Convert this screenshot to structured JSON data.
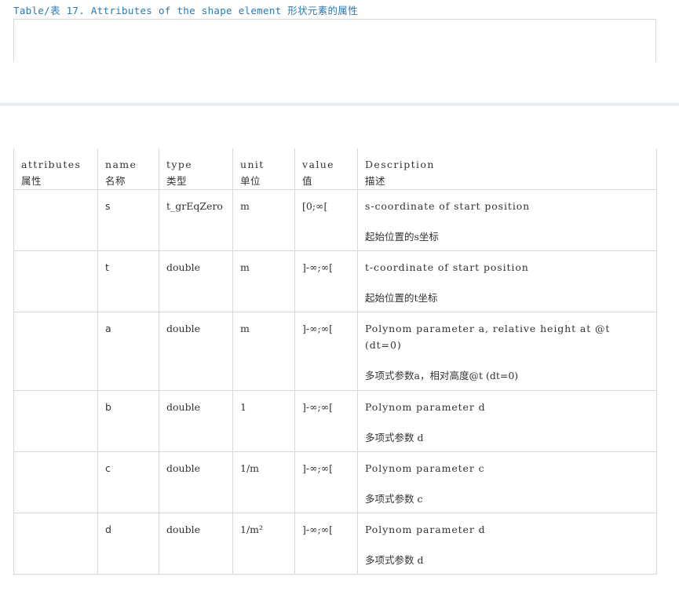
{
  "caption": "Table/表 17. Attributes of the shape element 形状元素的属性",
  "table": {
    "headers": {
      "attributes_en": "attributes",
      "attributes_cn": "属性",
      "name_en": "name",
      "name_cn": "名称",
      "type_en": "type",
      "type_cn": "类型",
      "unit_en": "unit",
      "unit_cn": "单位",
      "value_en": "value",
      "value_cn": "值",
      "desc_en": "Description",
      "desc_cn": "描述"
    },
    "rows": [
      {
        "attr": "",
        "name": "s",
        "type": "t_grEqZero",
        "unit": "m",
        "value": "[0;∞[",
        "desc_en": "s-coordinate of start position",
        "desc_cn": "起始位置的s坐标"
      },
      {
        "attr": "",
        "name": "t",
        "type": "double",
        "unit": "m",
        "value": "]-∞;∞[",
        "desc_en": "t-coordinate of start position",
        "desc_cn": "起始位置的t坐标"
      },
      {
        "attr": "",
        "name": "a",
        "type": "double",
        "unit": "m",
        "value": "]-∞;∞[",
        "desc_en": "Polynom parameter a, relative height at @t (dt=0)",
        "desc_cn": "多项式参数a，相对高度@t (dt=0)"
      },
      {
        "attr": "",
        "name": "b",
        "type": "double",
        "unit": "1",
        "value": "]-∞;∞[",
        "desc_en": "Polynom parameter d",
        "desc_cn": "多项式参数 d"
      },
      {
        "attr": "",
        "name": "c",
        "type": "double",
        "unit": "1/m",
        "value": "]-∞;∞[",
        "desc_en": "Polynom parameter c",
        "desc_cn": "多项式参数 c"
      },
      {
        "attr": "",
        "name": "d",
        "type": "double",
        "unit": "1/m²",
        "value": "]-∞;∞[",
        "desc_en": "Polynom parameter d",
        "desc_cn": "多项式参数 d"
      }
    ]
  }
}
